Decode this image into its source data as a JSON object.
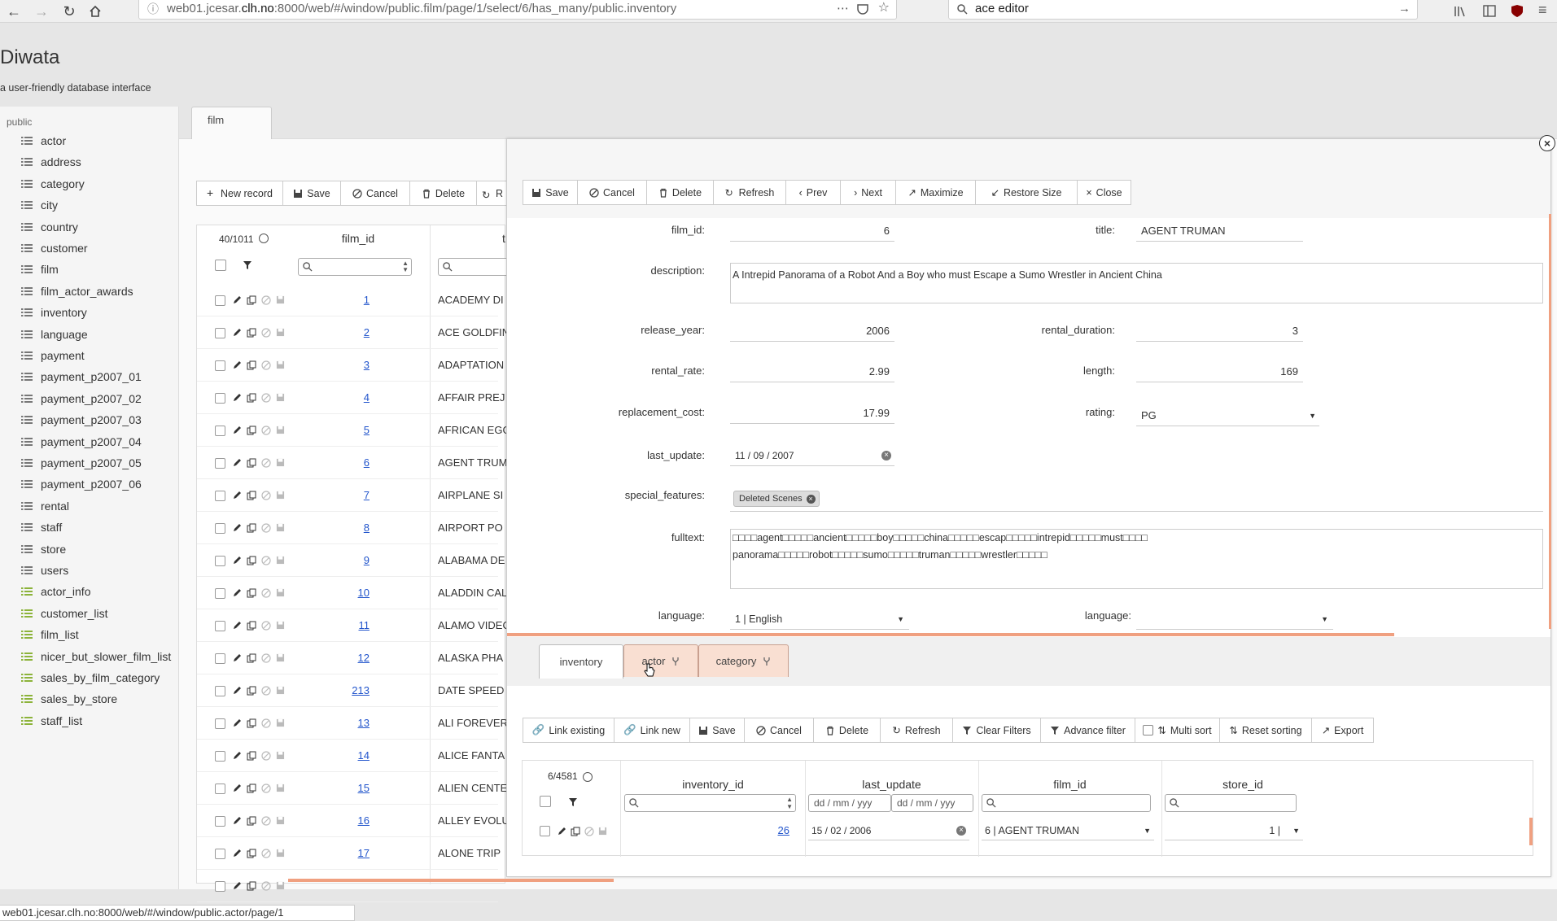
{
  "browser": {
    "url_prefix": "web01.jcesar.",
    "url_host": "clh.no",
    "url_rest": ":8000/web/#/window/public.film/page/1/select/6/has_many/public.inventory",
    "search_value": "ace editor"
  },
  "app": {
    "title": "Diwata",
    "subtitle": "a user-friendly database interface"
  },
  "sidebar": {
    "schema": "public",
    "tables": [
      "actor",
      "address",
      "category",
      "city",
      "country",
      "customer",
      "film",
      "film_actor_awards",
      "inventory",
      "language",
      "payment",
      "payment_p2007_01",
      "payment_p2007_02",
      "payment_p2007_03",
      "payment_p2007_04",
      "payment_p2007_05",
      "payment_p2007_06",
      "rental",
      "staff",
      "store",
      "users"
    ],
    "views": [
      "actor_info",
      "customer_list",
      "film_list",
      "nicer_but_slower_film_list",
      "sales_by_film_category",
      "sales_by_store",
      "staff_list"
    ]
  },
  "main": {
    "tab": "film",
    "toolbar": {
      "new_record": "New record",
      "save": "Save",
      "cancel": "Cancel",
      "delete": "Delete",
      "refresh_partial": "R"
    },
    "count": "40/1011",
    "col_film_id": "film_id",
    "col_title_partial": "t",
    "rows": [
      {
        "id": "1",
        "title": "ACADEMY DI"
      },
      {
        "id": "2",
        "title": "ACE GOLDFIN"
      },
      {
        "id": "3",
        "title": "ADAPTATION"
      },
      {
        "id": "4",
        "title": "AFFAIR PREJ"
      },
      {
        "id": "5",
        "title": "AFRICAN EGG"
      },
      {
        "id": "6",
        "title": "AGENT TRUM"
      },
      {
        "id": "7",
        "title": "AIRPLANE SI"
      },
      {
        "id": "8",
        "title": "AIRPORT PO"
      },
      {
        "id": "9",
        "title": "ALABAMA DE"
      },
      {
        "id": "10",
        "title": "ALADDIN CAL"
      },
      {
        "id": "11",
        "title": "ALAMO VIDEO"
      },
      {
        "id": "12",
        "title": "ALASKA PHA"
      },
      {
        "id": "213",
        "title": "DATE SPEED"
      },
      {
        "id": "13",
        "title": "ALI FOREVER"
      },
      {
        "id": "14",
        "title": "ALICE FANTA"
      },
      {
        "id": "15",
        "title": "ALIEN CENTE"
      },
      {
        "id": "16",
        "title": "ALLEY EVOLU"
      },
      {
        "id": "17",
        "title": "ALONE TRIP"
      },
      {
        "id": "",
        "title": ""
      }
    ]
  },
  "detail": {
    "toolbar": {
      "save": "Save",
      "cancel": "Cancel",
      "delete": "Delete",
      "refresh": "Refresh",
      "prev": "Prev",
      "next": "Next",
      "maximize": "Maximize",
      "restore": "Restore Size",
      "close": "Close"
    },
    "fields": {
      "film_id_label": "film_id:",
      "film_id": "6",
      "title_label": "title:",
      "title": "AGENT TRUMAN",
      "description_label": "description:",
      "description": "A Intrepid Panorama of a Robot And a Boy who must Escape a Sumo Wrestler in Ancient China",
      "release_year_label": "release_year:",
      "release_year": "2006",
      "rental_duration_label": "rental_duration:",
      "rental_duration": "3",
      "rental_rate_label": "rental_rate:",
      "rental_rate": "2.99",
      "length_label": "length:",
      "length": "169",
      "replacement_cost_label": "replacement_cost:",
      "replacement_cost": "17.99",
      "rating_label": "rating:",
      "rating": "PG",
      "last_update_label": "last_update:",
      "last_update": "11 / 09 / 2007",
      "special_features_label": "special_features:",
      "special_feature_tag": "Deleted Scenes",
      "fulltext_label": "fulltext:",
      "fulltext_line1": "□□□□agent□□□□□ancient□□□□□boy□□□□□china□□□□□escap□□□□□intrepid□□□□□must□□□□",
      "fulltext_line2": "panorama□□□□□robot□□□□□sumo□□□□□truman□□□□□wrestler□□□□□",
      "language_label": "language:",
      "language": "1  |  English",
      "language2_label": "language:"
    },
    "subtabs": {
      "inventory": "inventory",
      "actor": "actor",
      "category": "category"
    },
    "subtoolbar": {
      "link_existing": "Link existing",
      "link_new": "Link new",
      "save": "Save",
      "cancel": "Cancel",
      "delete": "Delete",
      "refresh": "Refresh",
      "clear_filters": "Clear Filters",
      "advance_filter": "Advance filter",
      "multi_sort": "Multi sort",
      "reset_sorting": "Reset sorting",
      "export": "Export"
    },
    "subgrid": {
      "count": "6/4581",
      "headers": {
        "inventory_id": "inventory_id",
        "last_update": "last_update",
        "film_id": "film_id",
        "store_id": "store_id"
      },
      "date_placeholder": "dd / mm / yyy",
      "row": {
        "inventory_id": "26",
        "last_update": "15 / 02 / 2006",
        "film_id": "6  |  AGENT TRUMAN",
        "store_id": "1  |"
      }
    }
  },
  "status": {
    "url": "web01.jcesar.clh.no:8000/web/#/window/public.actor/page/1"
  }
}
